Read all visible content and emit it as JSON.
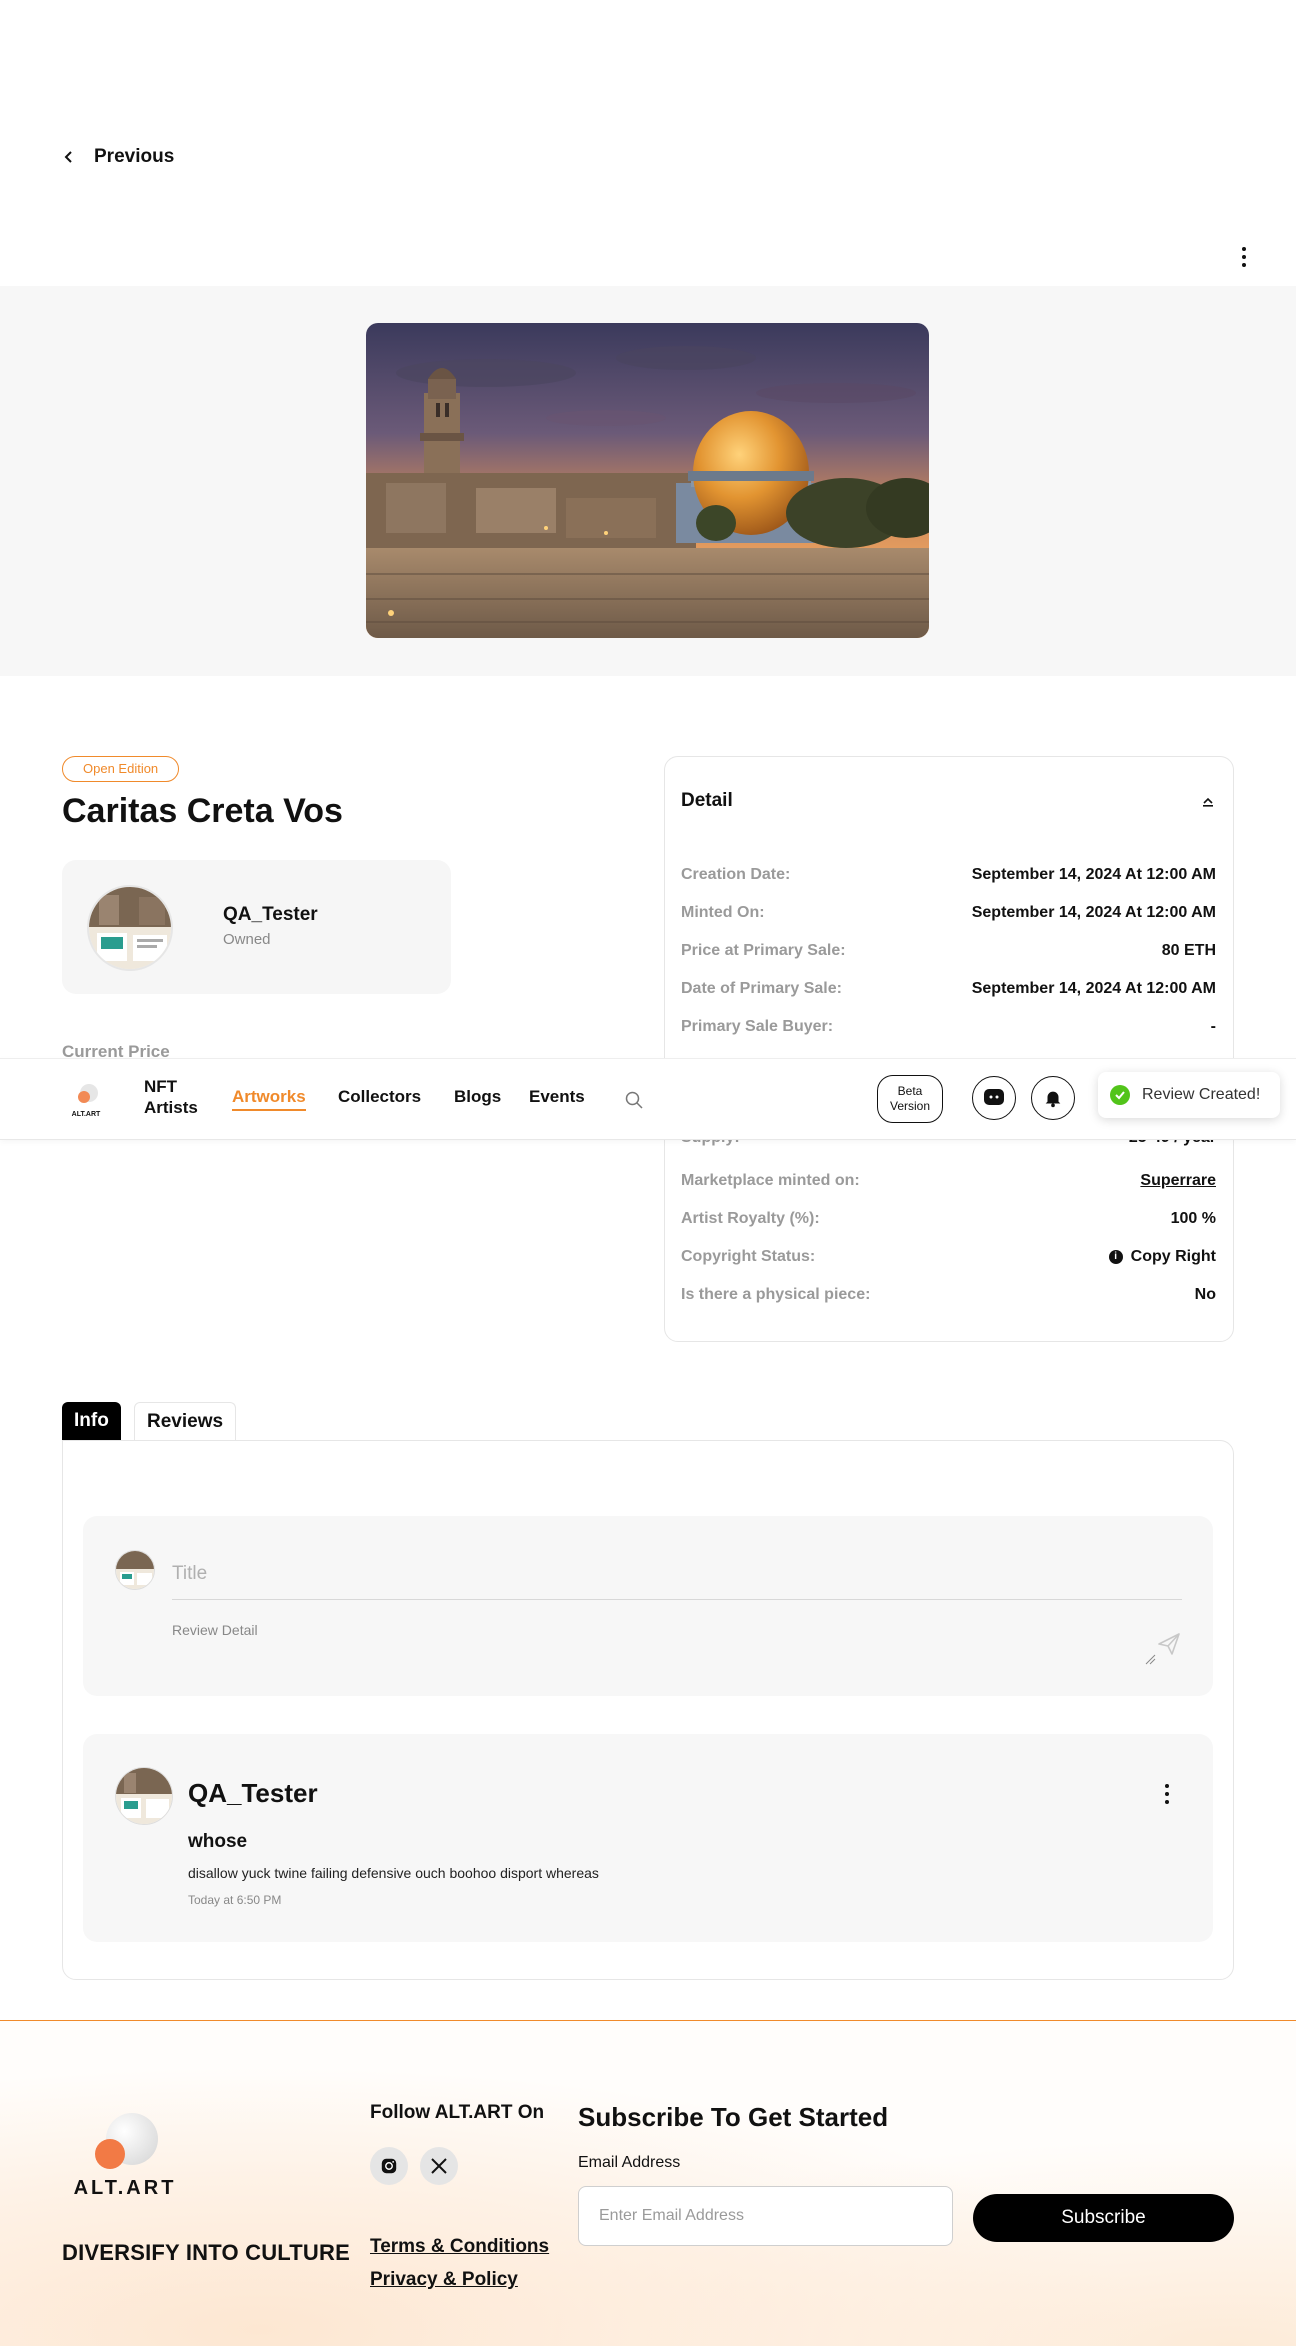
{
  "back": {
    "label": "Previous"
  },
  "artwork": {
    "edition_badge": "Open Edition",
    "title": "Caritas Creta Vos",
    "owner": {
      "name": "QA_Tester",
      "status": "Owned"
    },
    "current_price_label": "Current Price"
  },
  "detail": {
    "title": "Detail",
    "rows_top": [
      {
        "label": "Creation Date:",
        "value": "September 14, 2024 At 12:00 AM"
      },
      {
        "label": "Minted On:",
        "value": "September 14, 2024 At 12:00 AM"
      },
      {
        "label": "Price at Primary Sale:",
        "value": "80 ETH"
      },
      {
        "label": "Date of Primary Sale:",
        "value": "September 14, 2024 At 12:00 AM"
      },
      {
        "label": "Primary Sale Buyer:",
        "value": "-"
      }
    ],
    "rows_bottom": [
      {
        "label": "Supply:",
        "value": "25-49 / year"
      },
      {
        "label": "Marketplace minted on:",
        "value": "Superrare"
      },
      {
        "label": "Artist Royalty (%):",
        "value": "100 %"
      },
      {
        "label": "Copyright Status:",
        "value": "Copy Right"
      },
      {
        "label": "Is there a physical piece:",
        "value": "No"
      }
    ]
  },
  "nav": {
    "logo_text": "ALT.ART",
    "items": [
      "NFT Artists",
      "Artworks",
      "Collectors",
      "Blogs",
      "Events"
    ],
    "active": "Artworks",
    "beta": "Beta Version",
    "icons": [
      "search-icon",
      "chat-icon",
      "bell-icon"
    ]
  },
  "toast": {
    "message": "Review Created!"
  },
  "tabs": {
    "items": [
      "Info",
      "Reviews"
    ],
    "active": "Info"
  },
  "review_form": {
    "title_placeholder": "Title",
    "detail_placeholder": "Review Detail"
  },
  "review": {
    "user": "QA_Tester",
    "title": "whose",
    "body": "disallow yuck twine failing defensive ouch boohoo disport whereas",
    "time": "Today at 6:50 PM"
  },
  "footer": {
    "logo_text": "ALT.ART",
    "tagline": "DIVERSIFY INTO CULTURE",
    "follow_label": "Follow ALT.ART On",
    "social": [
      "instagram-icon",
      "x-icon"
    ],
    "links": [
      "Terms & Conditions",
      "Privacy & Policy"
    ],
    "subscribe_title": "Subscribe To Get Started",
    "email_label": "Email Address",
    "email_placeholder": "Enter Email Address",
    "subscribe_button": "Subscribe"
  },
  "colors": {
    "accent": "#f08a2b",
    "primary": "#000000",
    "muted": "#9a9a9a",
    "success": "#52c41a"
  }
}
